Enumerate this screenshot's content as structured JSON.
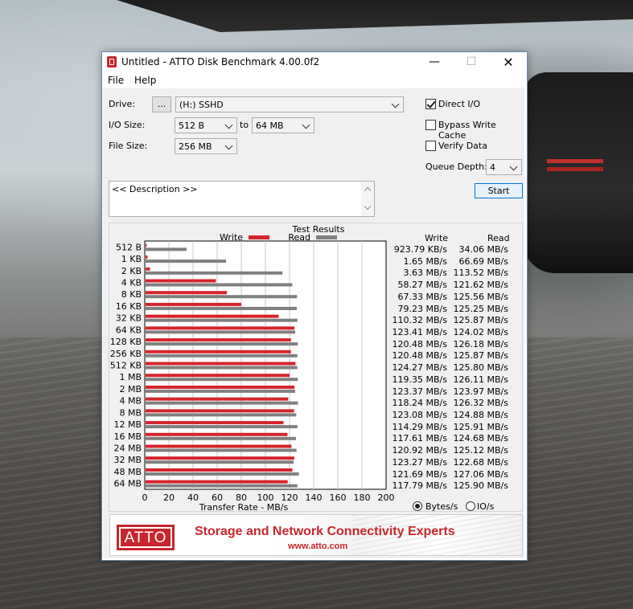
{
  "window": {
    "title": "Untitled - ATTO Disk Benchmark 4.00.0f2",
    "minimize": "—",
    "maximize": "☐",
    "close": "✕"
  },
  "menu": {
    "file": "File",
    "help": "Help"
  },
  "settings": {
    "drive_label": "Drive:",
    "browse_button": "...",
    "drive_value": "(H:) SSHD",
    "io_size_label": "I/O Size:",
    "io_size_from": "512 B",
    "to_label": "to",
    "io_size_to": "64 MB",
    "file_size_label": "File Size:",
    "file_size_value": "256 MB",
    "direct_io_label": "Direct I/O",
    "direct_io_checked": true,
    "bypass_write_cache_label": "Bypass Write Cache",
    "bypass_write_cache_checked": false,
    "verify_data_label": "Verify Data",
    "verify_data_checked": false,
    "queue_depth_label": "Queue Depth:",
    "queue_depth_value": "4",
    "description_placeholder": "<< Description >>",
    "start_button": "Start"
  },
  "results": {
    "header_write": "Write",
    "header_read": "Read",
    "write_values": [
      "923.79 KB/s",
      "1.65 MB/s",
      "3.63 MB/s",
      "58.27 MB/s",
      "67.33 MB/s",
      "79.23 MB/s",
      "110.32 MB/s",
      "123.41 MB/s",
      "120.48 MB/s",
      "120.48 MB/s",
      "124.27 MB/s",
      "119.35 MB/s",
      "123.37 MB/s",
      "118.24 MB/s",
      "123.08 MB/s",
      "114.29 MB/s",
      "117.61 MB/s",
      "120.92 MB/s",
      "123.27 MB/s",
      "121.69 MB/s",
      "117.79 MB/s"
    ],
    "read_values": [
      "34.06 MB/s",
      "66.69 MB/s",
      "113.52 MB/s",
      "121.62 MB/s",
      "125.56 MB/s",
      "125.25 MB/s",
      "125.87 MB/s",
      "124.02 MB/s",
      "126.18 MB/s",
      "125.87 MB/s",
      "125.80 MB/s",
      "126.11 MB/s",
      "123.97 MB/s",
      "126.32 MB/s",
      "124.88 MB/s",
      "125.91 MB/s",
      "124.68 MB/s",
      "125.12 MB/s",
      "122.68 MB/s",
      "127.06 MB/s",
      "125.90 MB/s"
    ],
    "unit_bytes_label": "Bytes/s",
    "unit_io_label": "IO/s",
    "unit_selected": "Bytes/s"
  },
  "chart_data": {
    "type": "bar",
    "orientation": "horizontal",
    "title": "Test Results",
    "xlabel": "Transfer Rate - MB/s",
    "xlim": [
      0,
      200
    ],
    "xticks": [
      "0",
      "20",
      "40",
      "60",
      "80",
      "100",
      "120",
      "140",
      "160",
      "180",
      "200"
    ],
    "grid": true,
    "legend_position": "top",
    "categories": [
      "512 B",
      "1 KB",
      "2 KB",
      "4 KB",
      "8 KB",
      "16 KB",
      "32 KB",
      "64 KB",
      "128 KB",
      "256 KB",
      "512 KB",
      "1 MB",
      "2 MB",
      "4 MB",
      "8 MB",
      "12 MB",
      "16 MB",
      "24 MB",
      "32 MB",
      "48 MB",
      "64 MB"
    ],
    "series": [
      {
        "name": "Write",
        "color": "#d4252b",
        "values": [
          0.9,
          1.65,
          3.63,
          58.27,
          67.33,
          79.23,
          110.32,
          123.41,
          120.48,
          120.48,
          124.27,
          119.35,
          123.37,
          118.24,
          123.08,
          114.29,
          117.61,
          120.92,
          123.27,
          121.69,
          117.79
        ]
      },
      {
        "name": "Read",
        "color": "#808080",
        "values": [
          34.06,
          66.69,
          113.52,
          121.62,
          125.56,
          125.25,
          125.87,
          124.02,
          126.18,
          125.87,
          125.8,
          126.11,
          123.97,
          126.32,
          124.88,
          125.91,
          124.68,
          125.12,
          122.68,
          127.06,
          125.9
        ]
      }
    ]
  },
  "banner": {
    "logo_text": "ATTO",
    "tagline": "Storage and Network Connectivity Experts",
    "url": "www.atto.com"
  }
}
